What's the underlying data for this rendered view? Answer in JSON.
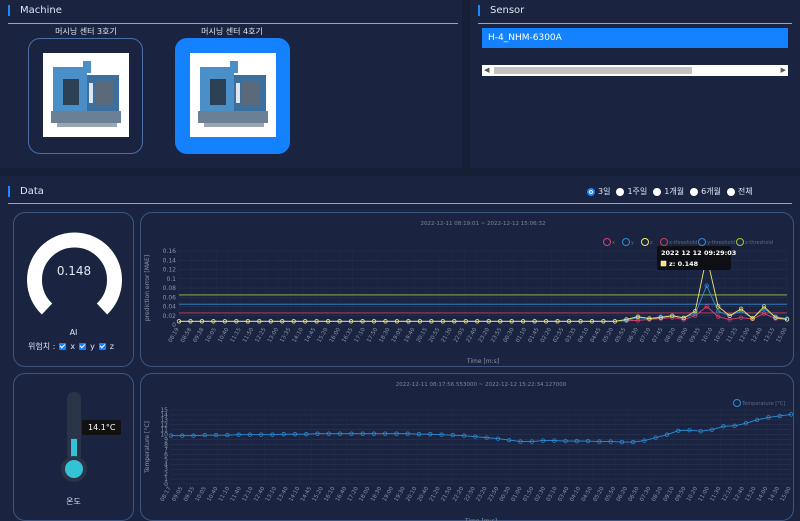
{
  "machine": {
    "title": "Machine",
    "cards": [
      {
        "label": "머시닝 센터 3호기",
        "active": false
      },
      {
        "label": "머시닝 센터 4호기",
        "active": true
      }
    ]
  },
  "sensor": {
    "title": "Sensor",
    "selected": "H-4_NHM-6300A"
  },
  "data_section": {
    "title": "Data",
    "ranges": [
      {
        "label": "3일",
        "selected": true
      },
      {
        "label": "1주일",
        "selected": false
      },
      {
        "label": "1개월",
        "selected": false
      },
      {
        "label": "6개월",
        "selected": false
      },
      {
        "label": "전체",
        "selected": false
      }
    ]
  },
  "ai_gauge": {
    "value": "0.148",
    "fraction": 0.148,
    "label": "AI",
    "risk_label": "위험치 :",
    "checks": [
      "x",
      "y",
      "z"
    ]
  },
  "thermo": {
    "value": "14.1°C",
    "label": "온도",
    "fraction": 0.35
  },
  "colors": {
    "accent": "#1482ff",
    "x": "#e0406e",
    "y": "#2f8fd8",
    "z": "#f2e66b",
    "x_threshold": "#c8405e",
    "y_threshold": "#3a88d0",
    "z_threshold": "#9ec83a",
    "temp": "#2f8fd8"
  },
  "chart_data": [
    {
      "type": "line",
      "title": "2022-12-11 08:19:01 ~ 2022-12-12 15:06:32",
      "xlabel": "Time [m:s]",
      "ylabel": "prediction error [MAE]",
      "ylim": [
        0,
        0.16
      ],
      "yticks": [
        "0",
        "0.02",
        "0.04",
        "0.06",
        "0.08",
        "0.1",
        "0.12",
        "0.14",
        "0.16"
      ],
      "xticks": [
        "08:19",
        "08:58",
        "09:38",
        "10:05",
        "10:40",
        "11:15",
        "11:50",
        "12:25",
        "13:00",
        "13:35",
        "14:10",
        "14:45",
        "15:20",
        "16:00",
        "16:35",
        "17:10",
        "17:50",
        "18:30",
        "19:05",
        "19:40",
        "20:15",
        "20:55",
        "21:30",
        "22:05",
        "22:40",
        "23:20",
        "23:55",
        "00:30",
        "01:10",
        "01:45",
        "02:20",
        "02:55",
        "03:35",
        "04:10",
        "04:45",
        "05:20",
        "05:55",
        "06:30",
        "07:10",
        "07:45",
        "08:20",
        "09:00",
        "09:35",
        "10:10",
        "10:50",
        "11:25",
        "12:00",
        "12:40",
        "13:15",
        "15:00"
      ],
      "legend": [
        "x",
        "y",
        "z",
        "x-threshold",
        "y-threshold",
        "z-threshold"
      ],
      "legend_position": "top-right",
      "thresholds": {
        "x_threshold": 0.026,
        "y_threshold": 0.045,
        "z_threshold": 0.065
      },
      "series": [
        {
          "name": "x",
          "values": [
            0.008,
            0.008,
            0.008,
            0.008,
            0.008,
            0.008,
            0.008,
            0.008,
            0.008,
            0.008,
            0.008,
            0.008,
            0.008,
            0.008,
            0.008,
            0.008,
            0.008,
            0.008,
            0.008,
            0.008,
            0.008,
            0.008,
            0.008,
            0.008,
            0.008,
            0.008,
            0.008,
            0.008,
            0.008,
            0.008,
            0.008,
            0.008,
            0.008,
            0.008,
            0.008,
            0.008,
            0.008,
            0.008,
            0.008,
            0.009,
            0.01,
            0.012,
            0.014,
            0.016,
            0.012,
            0.02,
            0.04,
            0.018,
            0.012,
            0.016,
            0.013,
            0.025,
            0.014,
            0.012
          ]
        },
        {
          "name": "y",
          "values": [
            0.008,
            0.008,
            0.008,
            0.008,
            0.008,
            0.008,
            0.008,
            0.008,
            0.008,
            0.008,
            0.008,
            0.008,
            0.008,
            0.008,
            0.008,
            0.008,
            0.008,
            0.008,
            0.008,
            0.008,
            0.008,
            0.008,
            0.008,
            0.008,
            0.008,
            0.008,
            0.008,
            0.008,
            0.008,
            0.008,
            0.008,
            0.008,
            0.008,
            0.008,
            0.008,
            0.008,
            0.008,
            0.008,
            0.008,
            0.01,
            0.016,
            0.014,
            0.018,
            0.02,
            0.016,
            0.024,
            0.085,
            0.03,
            0.02,
            0.03,
            0.015,
            0.035,
            0.018,
            0.014
          ]
        },
        {
          "name": "z",
          "values": [
            0.008,
            0.008,
            0.008,
            0.008,
            0.008,
            0.008,
            0.008,
            0.008,
            0.008,
            0.008,
            0.008,
            0.008,
            0.008,
            0.008,
            0.008,
            0.008,
            0.008,
            0.008,
            0.008,
            0.008,
            0.008,
            0.008,
            0.008,
            0.008,
            0.008,
            0.008,
            0.008,
            0.008,
            0.008,
            0.008,
            0.008,
            0.008,
            0.008,
            0.008,
            0.008,
            0.008,
            0.008,
            0.008,
            0.008,
            0.012,
            0.018,
            0.014,
            0.016,
            0.02,
            0.015,
            0.03,
            0.148,
            0.04,
            0.02,
            0.035,
            0.014,
            0.04,
            0.016,
            0.012
          ]
        }
      ],
      "tooltip": {
        "time": "2022 12 12 09:29:03",
        "text": "z: 0.148"
      }
    },
    {
      "type": "line",
      "title": "2022-12-11 08:17:56.553000 ~ 2022-12-12 15:22:34.127000",
      "xlabel": "Time [m:s]",
      "ylabel": "Temperature [°C]",
      "ylim": [
        0,
        15
      ],
      "yticks": [
        "0",
        "1",
        "2",
        "3",
        "4",
        "5",
        "6",
        "7",
        "8",
        "9",
        "10",
        "11",
        "12",
        "13",
        "14",
        "15"
      ],
      "xticks": [
        "08:17",
        "09:05",
        "09:35",
        "10:05",
        "10:40",
        "11:10",
        "11:40",
        "12:10",
        "12:40",
        "13:10",
        "13:40",
        "14:10",
        "14:45",
        "15:20",
        "16:10",
        "16:40",
        "17:20",
        "18:00",
        "18:30",
        "19:00",
        "19:30",
        "20:10",
        "20:40",
        "21:20",
        "21:50",
        "22:20",
        "22:50",
        "23:20",
        "23:50",
        "00:30",
        "01:00",
        "01:50",
        "02:30",
        "03:10",
        "03:40",
        "04:10",
        "04:50",
        "05:20",
        "05:50",
        "06:20",
        "06:50",
        "07:30",
        "08:20",
        "09:10",
        "09:50",
        "10:20",
        "11:00",
        "11:30",
        "12:10",
        "12:40",
        "13:20",
        "14:00",
        "14:30",
        "15:00"
      ],
      "legend": [
        "Temperature [°C]"
      ],
      "legend_position": "top-right",
      "series": [
        {
          "name": "Temperature [°C]",
          "values": [
            9.8,
            9.8,
            9.8,
            9.9,
            9.9,
            9.9,
            10.0,
            10.0,
            10.0,
            10.0,
            10.1,
            10.1,
            10.1,
            10.2,
            10.2,
            10.2,
            10.2,
            10.2,
            10.2,
            10.2,
            10.2,
            10.2,
            10.1,
            10.1,
            10.0,
            9.9,
            9.8,
            9.6,
            9.4,
            9.2,
            8.9,
            8.6,
            8.6,
            8.8,
            8.8,
            8.7,
            8.7,
            8.7,
            8.6,
            8.6,
            8.5,
            8.5,
            8.8,
            9.4,
            10.0,
            10.8,
            10.9,
            10.7,
            11.0,
            11.7,
            11.8,
            12.3,
            13.0,
            13.5,
            13.8,
            14.1
          ]
        }
      ]
    }
  ]
}
